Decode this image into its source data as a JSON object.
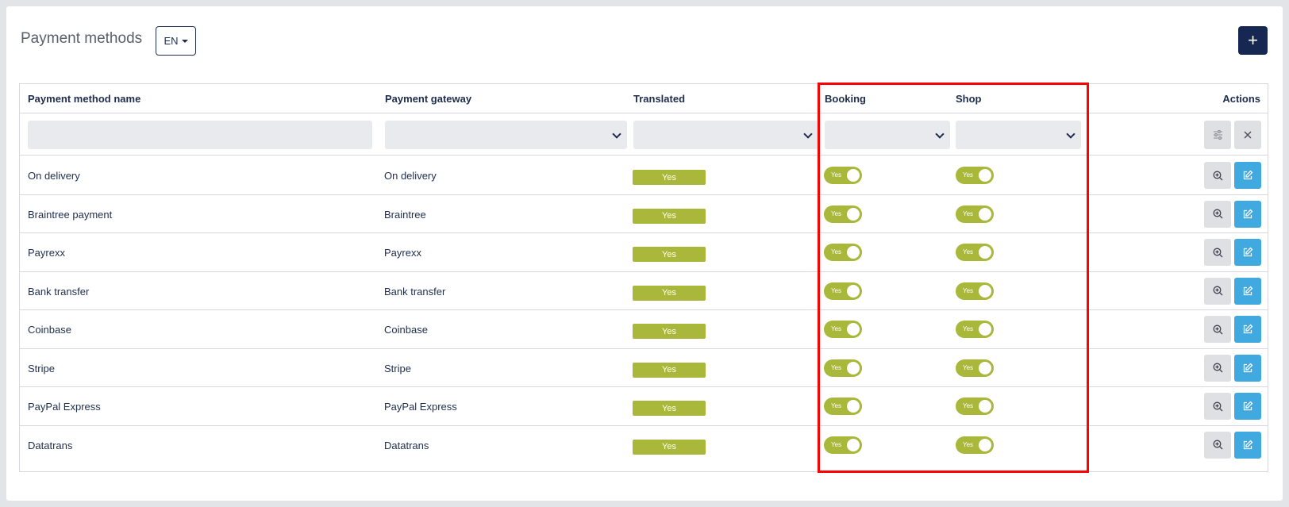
{
  "page": {
    "title": "Payment methods",
    "language": "EN",
    "add_label": "+"
  },
  "columns": {
    "name": "Payment method name",
    "gateway": "Payment gateway",
    "translated": "Translated",
    "booking": "Booking",
    "shop": "Shop",
    "actions": "Actions"
  },
  "rows": [
    {
      "name": "On delivery",
      "gateway": "On delivery",
      "translated": "Yes",
      "booking": "Yes",
      "shop": "Yes"
    },
    {
      "name": "Braintree payment",
      "gateway": "Braintree",
      "translated": "Yes",
      "booking": "Yes",
      "shop": "Yes"
    },
    {
      "name": "Payrexx",
      "gateway": "Payrexx",
      "translated": "Yes",
      "booking": "Yes",
      "shop": "Yes"
    },
    {
      "name": "Bank transfer",
      "gateway": "Bank transfer",
      "translated": "Yes",
      "booking": "Yes",
      "shop": "Yes"
    },
    {
      "name": "Coinbase",
      "gateway": "Coinbase",
      "translated": "Yes",
      "booking": "Yes",
      "shop": "Yes"
    },
    {
      "name": "Stripe",
      "gateway": "Stripe",
      "translated": "Yes",
      "booking": "Yes",
      "shop": "Yes"
    },
    {
      "name": "PayPal Express",
      "gateway": "PayPal Express",
      "translated": "Yes",
      "booking": "Yes",
      "shop": "Yes"
    },
    {
      "name": "Datatrans",
      "gateway": "Datatrans",
      "translated": "Yes",
      "booking": "Yes",
      "shop": "Yes"
    }
  ],
  "icons": {
    "view": "zoom-in-icon",
    "edit": "edit-icon",
    "filter": "filter-sliders-icon",
    "clear": "close-icon"
  },
  "colors": {
    "accent_green": "#a9b83a",
    "primary_navy": "#162752",
    "edit_blue": "#3fa9e0",
    "highlight_red": "#ff0000"
  }
}
